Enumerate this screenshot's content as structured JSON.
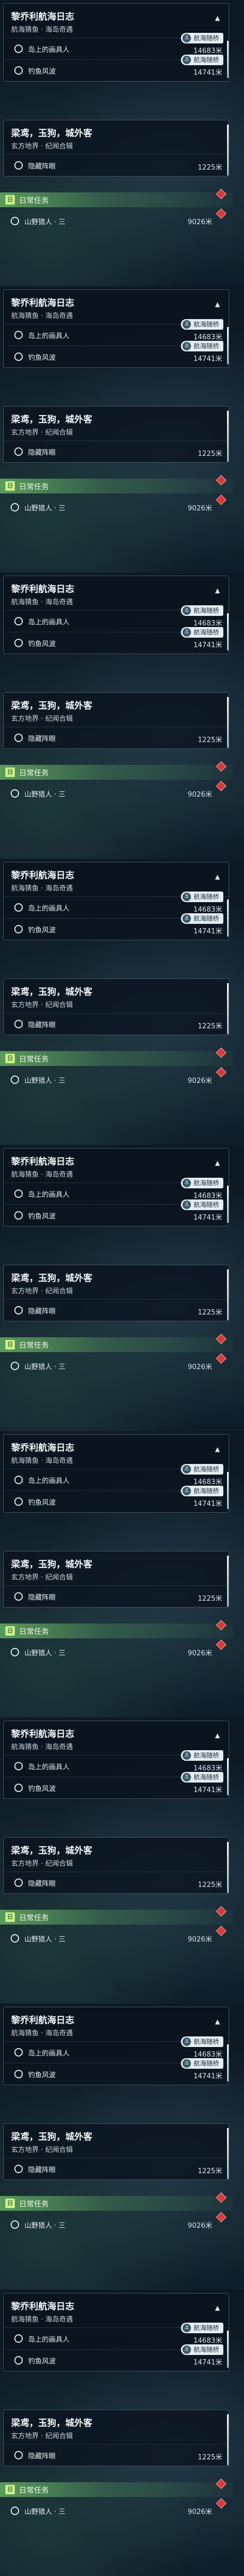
{
  "quest_log": [
    {
      "title": "黎乔利航海日志",
      "subtitle": "航海猜鱼 · 海岛奇遇",
      "collapse_icon": "▲",
      "badge_1": "航海随桥",
      "badge_2": "航海随桥",
      "tasks": [
        {
          "name": "岛上的画具人",
          "distance": "14683米"
        },
        {
          "name": "钓鱼风波",
          "distance": "14741米"
        }
      ]
    },
    {
      "title": "梁鸢，玉狗，城外客",
      "subtitle": "玄方地界 · 纪闻合辑",
      "tasks": [
        {
          "name": "隐藏阵眼",
          "distance": "1225米"
        }
      ]
    }
  ],
  "daily": {
    "tag": "日",
    "label": "日常任务",
    "task": {
      "name": "山野猎人 · 三",
      "distance": "9026米"
    }
  },
  "colors": {
    "accent_green": "#c8f08a",
    "alert_red": "#d83a3a",
    "panel_bg": "#0a141e"
  }
}
